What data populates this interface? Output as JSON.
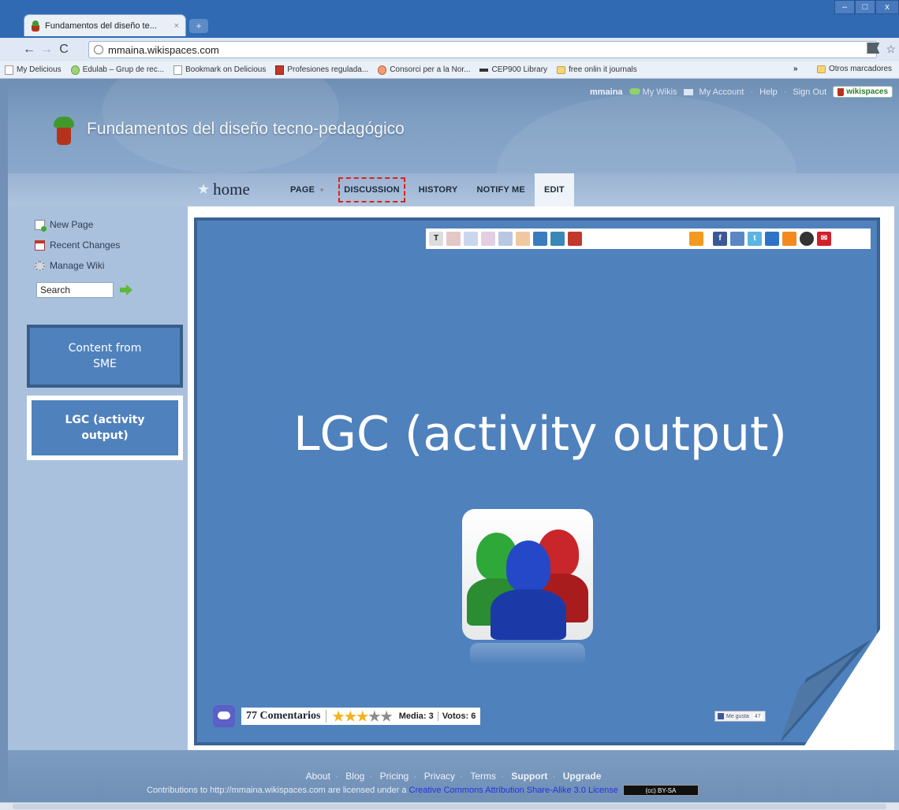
{
  "browser": {
    "tab_title": "Fundamentos del diseño te...",
    "tab_close": "×",
    "new_tab": "+",
    "url": "mmaina.wikispaces.com",
    "window_controls": [
      "–",
      "□",
      "x"
    ],
    "bookmarks": [
      {
        "label": "My Delicious",
        "icon": "page-icon"
      },
      {
        "label": "Edulab – Grup de rec...",
        "icon": "leaf-icon"
      },
      {
        "label": "Bookmark on Delicious",
        "icon": "page-icon"
      },
      {
        "label": "Profesiones regulada...",
        "icon": "pro-icon"
      },
      {
        "label": "Consorci per a la Nor...",
        "icon": "con-icon"
      },
      {
        "label": "CEP900 Library",
        "icon": "cep-icon"
      },
      {
        "label": "free onlin it journals",
        "icon": "folder-icon"
      }
    ],
    "bookmarks_more": "»",
    "bookmarks_other": "Otros marcadores"
  },
  "wiki": {
    "top_links": {
      "user": "mmaina",
      "my_wikis": "My Wikis",
      "my_account": "My Account",
      "help": "Help",
      "sign_out": "Sign Out",
      "brand": "wikispaces"
    },
    "site_title": "Fundamentos del diseño tecno-pedagógico",
    "nav": {
      "home": "home",
      "tabs": [
        "PAGE",
        "DISCUSSION",
        "HISTORY",
        "NOTIFY ME",
        "EDIT"
      ]
    },
    "sidebar": {
      "links": [
        "New Page",
        "Recent Changes",
        "Manage Wiki"
      ],
      "search_value": "Search"
    },
    "footer": {
      "links": [
        "About",
        "Blog",
        "Pricing",
        "Privacy",
        "Terms",
        "Support",
        "Upgrade"
      ],
      "license_text": "Contributions to http://mmaina.wikispaces.com are licensed under a",
      "license_link": "Creative Commons Attribution Share-Alike 3.0 License",
      "cc_badge": "(cc) BY-SA"
    }
  },
  "overlay": {
    "callout_sme": "Content from SME",
    "callout_lgc": "LGC (activity output)",
    "slide_title": "LGC (activity output)"
  },
  "rating": {
    "comments": "77 Comentarios",
    "stars_filled": 3,
    "stars_total": 5,
    "media": "Media: 3",
    "votos": "Votos: 6",
    "fb_like": "Me gusta",
    "fb_count": "47"
  },
  "colors": {
    "slide_fill": "#4f81bd",
    "slide_border": "#3a6394",
    "highlight": "#e02020"
  }
}
